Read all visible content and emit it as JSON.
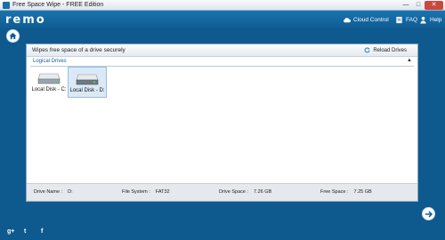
{
  "window": {
    "title": "Free Space Wipe - FREE Edition",
    "min_glyph": "—",
    "max_glyph": "□",
    "close_glyph": "✕"
  },
  "header": {
    "logo": "remo",
    "links": [
      {
        "label": "Cloud Control",
        "icon": "cloud-icon"
      },
      {
        "label": "FAQ",
        "icon": "faq-icon"
      },
      {
        "label": "Help",
        "icon": "help-icon"
      }
    ]
  },
  "panel": {
    "title": "Wipes free space of a drive securely",
    "reload_label": "Reload Drives",
    "section_label": "Logical Drives",
    "collapse_glyph": "▲",
    "drives": [
      {
        "label": "Local Disk - C:",
        "selected": false
      },
      {
        "label": "Local Disk - D:",
        "selected": true
      }
    ]
  },
  "info": {
    "drive_name_label": "Drive Name :",
    "drive_name_value": "D:",
    "file_system_label": "File System :",
    "file_system_value": "FAT32",
    "drive_space_label": "Drive Space :",
    "drive_space_value": "7.26 GB",
    "free_space_label": "Free Space :",
    "free_space_value": "7.25 GB"
  },
  "social": {
    "gplus": "g+",
    "twitter": "t",
    "facebook": "f"
  },
  "colors": {
    "background": "#0e5a8e",
    "header": "#1a74b0",
    "selected_drive": "#dbe9f7",
    "section_label": "#1f5fa0"
  }
}
